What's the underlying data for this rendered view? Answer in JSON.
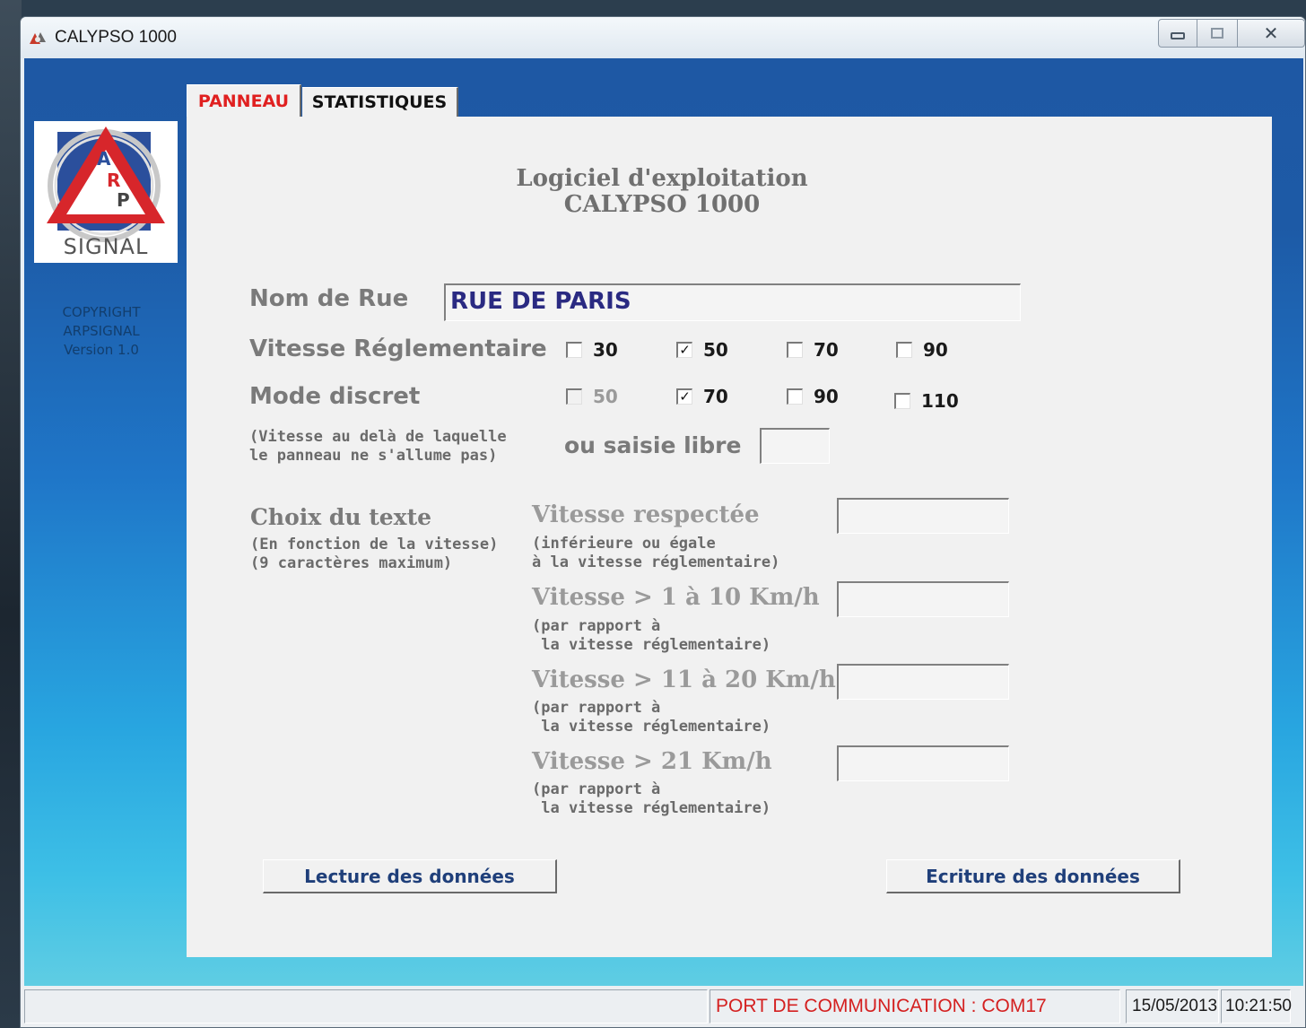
{
  "window": {
    "title": "CALYPSO 1000",
    "controls": {
      "minimize": "—",
      "maximize": "□",
      "close": "✕"
    }
  },
  "sidebar": {
    "logo_letters": [
      "A",
      "R",
      "P"
    ],
    "logo_text": "SIGNAL",
    "copyright_lines": [
      "COPYRIGHT",
      "ARPSIGNAL",
      "Version 1.0"
    ]
  },
  "tabs": [
    {
      "label": "PANNEAU",
      "active": true
    },
    {
      "label": "STATISTIQUES",
      "active": false
    }
  ],
  "panel": {
    "heading_line1": "Logiciel d'exploitation",
    "heading_line2": "CALYPSO 1000",
    "street": {
      "label": "Nom de Rue",
      "value": "RUE DE PARIS"
    },
    "speed_limit": {
      "label": "Vitesse Réglementaire",
      "options": [
        {
          "label": "30",
          "checked": false
        },
        {
          "label": "50",
          "checked": true
        },
        {
          "label": "70",
          "checked": false
        },
        {
          "label": "90",
          "checked": false
        }
      ]
    },
    "discreet_mode": {
      "label": "Mode discret",
      "note_line1": "(Vitesse au delà de laquelle",
      "note_line2": "le panneau ne s'allume pas)",
      "options": [
        {
          "label": "50",
          "checked": false,
          "disabled": true
        },
        {
          "label": "70",
          "checked": true,
          "disabled": false
        },
        {
          "label": "90",
          "checked": false,
          "disabled": false
        },
        {
          "label": "110",
          "checked": false,
          "disabled": false
        }
      ],
      "free_entry_label": "ou saisie libre",
      "free_entry_value": ""
    },
    "text_choice": {
      "label": "Choix du texte",
      "note_line1": "(En fonction de la vitesse)",
      "note_line2": "(9 caractères maximum)",
      "rows": [
        {
          "label": "Vitesse respectée",
          "note_line1": "(inférieure ou égale",
          "note_line2": "à la vitesse réglementaire)",
          "value": ""
        },
        {
          "label": "Vitesse > 1 à 10 Km/h",
          "note_line1": "(par rapport à",
          "note_line2": " la vitesse réglementaire)",
          "value": ""
        },
        {
          "label": "Vitesse > 11 à 20 Km/h",
          "note_line1": "(par rapport à",
          "note_line2": " la vitesse réglementaire)",
          "value": ""
        },
        {
          "label": "Vitesse > 21 Km/h",
          "note_line1": "(par rapport à",
          "note_line2": " la vitesse réglementaire)",
          "value": ""
        }
      ]
    },
    "buttons": {
      "read": "Lecture des données",
      "write": "Ecriture des données"
    }
  },
  "statusbar": {
    "port": "PORT DE COMMUNICATION : COM17",
    "date": "15/05/2013",
    "time": "10:21:50"
  },
  "colors": {
    "accent_red": "#e02020",
    "title_blue": "#2a2a82",
    "button_text": "#1f3f7a"
  }
}
